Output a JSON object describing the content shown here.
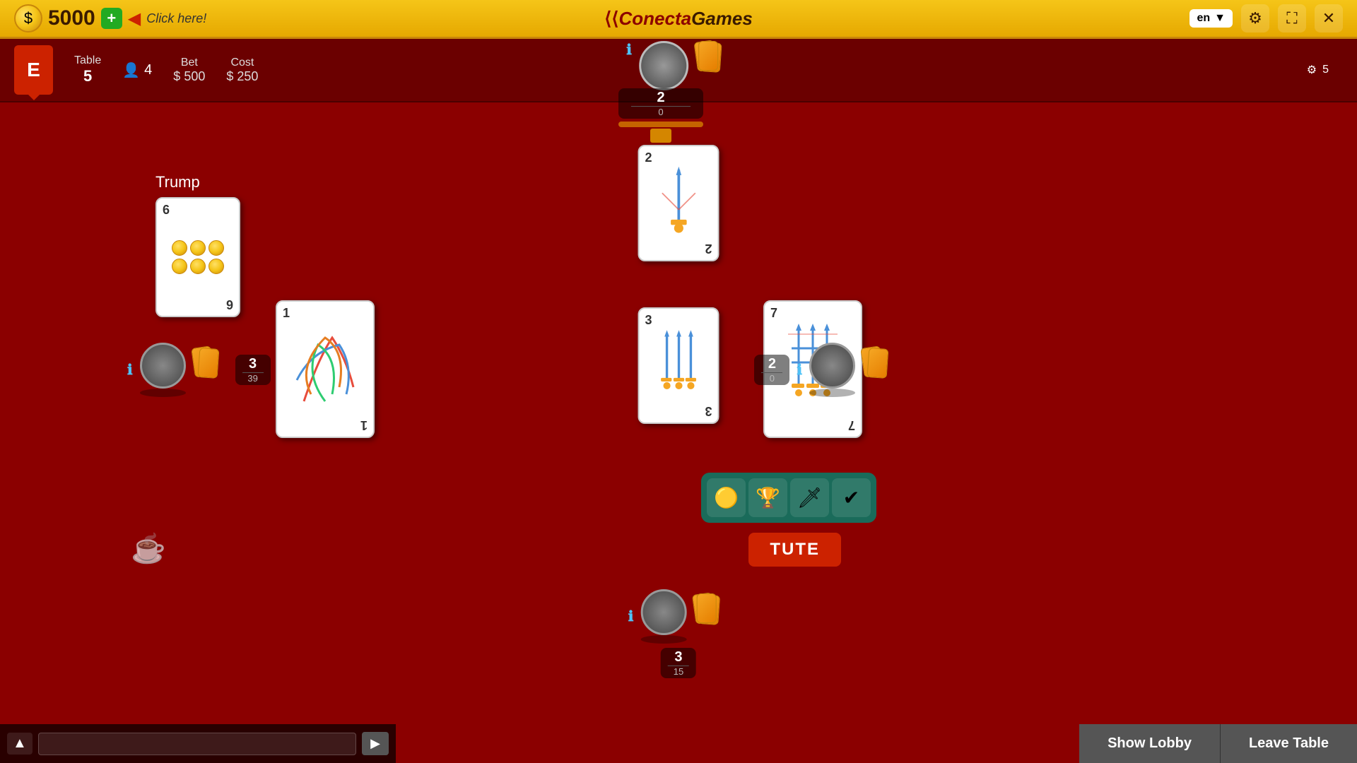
{
  "header": {
    "balance": "5000",
    "add_label": "+",
    "click_here": "Click here!",
    "logo_text1": "ConectaGames",
    "lang": "en",
    "icons": {
      "settings": "⚙",
      "fullscreen": "⛶",
      "close": "✕",
      "chevron": "▼"
    }
  },
  "info_bar": {
    "player_badge": "E",
    "table_label": "Table",
    "table_value": "5",
    "players_label": "",
    "players_value": "4",
    "bet_label": "Bet",
    "bet_prefix": "$",
    "bet_value": "500",
    "cost_label": "Cost",
    "cost_prefix": "$",
    "cost_value": "250",
    "gear_count": "5"
  },
  "trump": {
    "label": "Trump",
    "card_number": "6",
    "pips": 6
  },
  "players": {
    "top": {
      "score": "2",
      "score_sub": "0",
      "cards_count": "?"
    },
    "left": {
      "score": "3",
      "score_sub": "39",
      "info": "i"
    },
    "right": {
      "score": "2",
      "score_sub": "0",
      "info": "i"
    },
    "bottom": {
      "score": "3",
      "score_sub": "15",
      "info": "i"
    }
  },
  "center_cards": {
    "top_card_num": "2",
    "bottom_card_num": "3",
    "left_card_num": "1",
    "right_card_num": "7"
  },
  "suit_filter": {
    "coins": "🟡",
    "cups": "🏆",
    "swords": "🗡",
    "clubs": "✔"
  },
  "tute_label": "TUTE",
  "chat": {
    "placeholder": "",
    "send_icon": "▶"
  },
  "bottom_buttons": {
    "show_lobby": "Show Lobby",
    "leave_table": "Leave Table"
  }
}
